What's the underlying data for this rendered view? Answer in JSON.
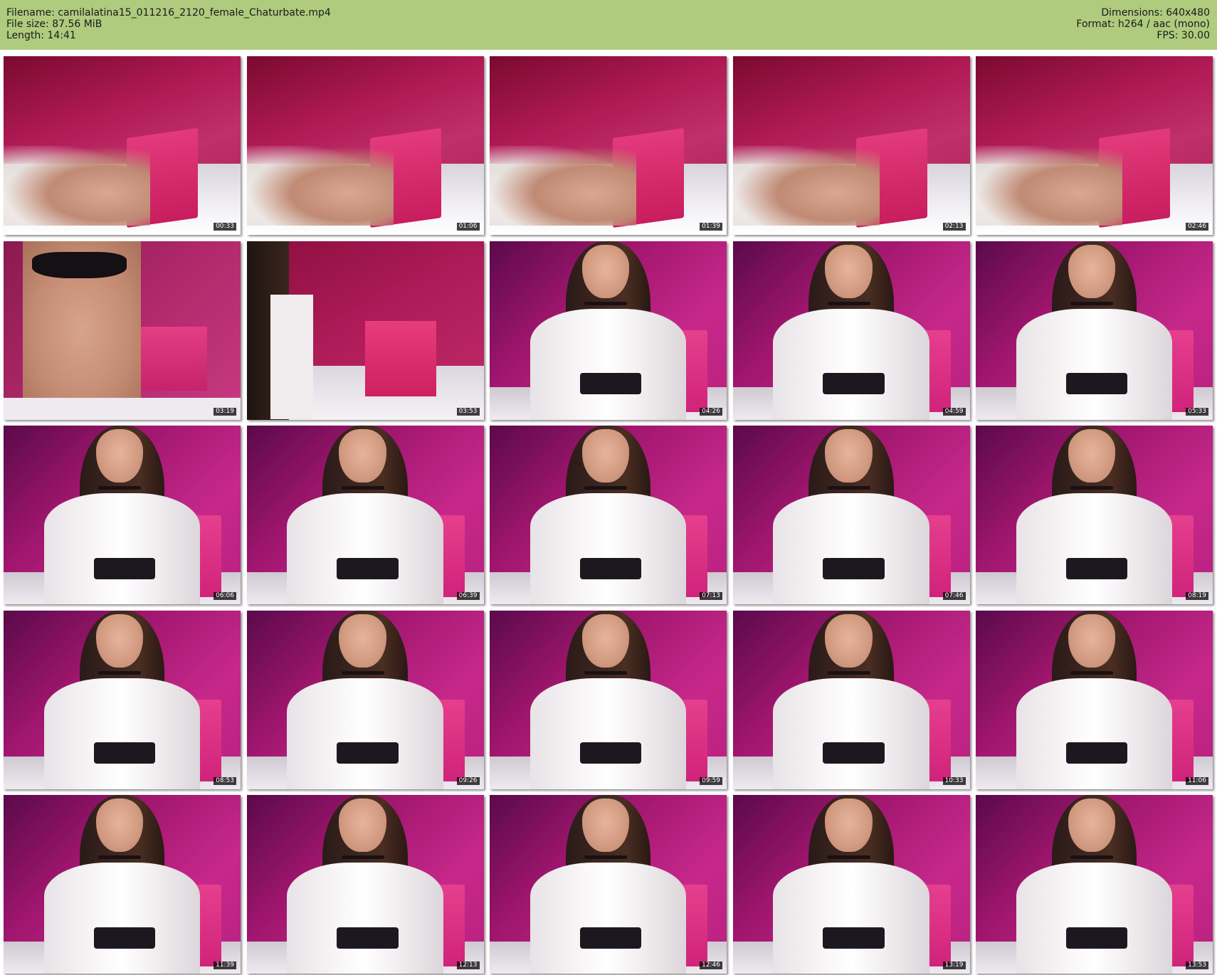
{
  "header": {
    "filename_line": "Filename: camilalatina15_011216_2120_female_Chaturbate.mp4",
    "filesize_line": "File size: 87.56 MiB",
    "length_line": "Length: 14:41",
    "dimensions_line": "Dimensions: 640x480",
    "format_line": "Format: h264 / aac (mono)",
    "fps_line": "FPS: 30.00",
    "background_color": "#aecb7e"
  },
  "thumbnails": [
    {
      "timestamp": "00:33",
      "scene": "bed-cushion"
    },
    {
      "timestamp": "01:06",
      "scene": "bed-cushion"
    },
    {
      "timestamp": "01:39",
      "scene": "bed-cushion"
    },
    {
      "timestamp": "02:13",
      "scene": "bed-cushion"
    },
    {
      "timestamp": "02:46",
      "scene": "bed-cushion"
    },
    {
      "timestamp": "03:19",
      "scene": "torso-closeup"
    },
    {
      "timestamp": "03:53",
      "scene": "hair-edge"
    },
    {
      "timestamp": "04:26",
      "scene": "person-seated"
    },
    {
      "timestamp": "04:59",
      "scene": "person-seated"
    },
    {
      "timestamp": "05:33",
      "scene": "person-seated"
    },
    {
      "timestamp": "06:06",
      "scene": "person-seated"
    },
    {
      "timestamp": "06:39",
      "scene": "person-seated"
    },
    {
      "timestamp": "07:13",
      "scene": "person-seated"
    },
    {
      "timestamp": "07:46",
      "scene": "person-seated"
    },
    {
      "timestamp": "08:19",
      "scene": "person-seated"
    },
    {
      "timestamp": "08:53",
      "scene": "person-seated"
    },
    {
      "timestamp": "09:26",
      "scene": "person-seated"
    },
    {
      "timestamp": "09:59",
      "scene": "person-seated"
    },
    {
      "timestamp": "10:33",
      "scene": "person-seated"
    },
    {
      "timestamp": "11:06",
      "scene": "person-seated"
    },
    {
      "timestamp": "11:39",
      "scene": "person-seated"
    },
    {
      "timestamp": "12:13",
      "scene": "person-seated"
    },
    {
      "timestamp": "12:46",
      "scene": "person-seated"
    },
    {
      "timestamp": "13:19",
      "scene": "person-seated"
    },
    {
      "timestamp": "13:53",
      "scene": "person-seated"
    }
  ]
}
